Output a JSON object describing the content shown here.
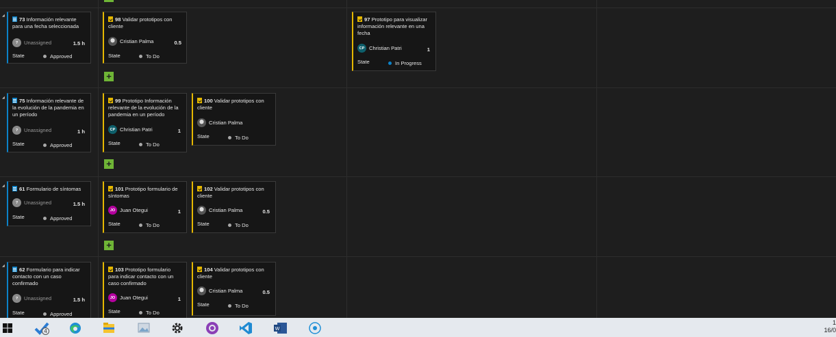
{
  "board": {
    "rows": [
      {
        "pbi": {
          "id": "73",
          "title": "Información relevante para una fecha seleccionada",
          "assignee": "Unassigned",
          "hours": "1.5 h",
          "state_label": "State",
          "state": "Approved"
        },
        "tasks": [
          {
            "id": "98",
            "title": "Validar prototipos con cliente",
            "assignee": "Cristian Palma",
            "avatar": "photo",
            "hours": "0.5",
            "state_label": "State",
            "state": "To Do"
          },
          {
            "id": "97",
            "title": "Prototipo para visualizar información relevante en una fecha",
            "assignee": "Christian Patri",
            "avatar_initials": "CP",
            "hours": "1",
            "state_label": "State",
            "state": "In Progress"
          }
        ]
      },
      {
        "pbi": {
          "id": "75",
          "title": "Información relevante de la evolución de la pandemia en un período",
          "assignee": "Unassigned",
          "hours": "1 h",
          "state_label": "State",
          "state": "Approved"
        },
        "tasks": [
          {
            "id": "99",
            "title": "Prototipo Información relevante de la evolución de la pandemia en un período",
            "assignee": "Christian Patri",
            "avatar_initials": "CP",
            "hours": "1",
            "state_label": "State",
            "state": "To Do"
          },
          {
            "id": "100",
            "title": "Validar prototipos con cliente",
            "assignee": "Cristian Palma",
            "avatar": "photo",
            "hours": "",
            "state_label": "State",
            "state": "To Do"
          }
        ]
      },
      {
        "pbi": {
          "id": "61",
          "title": "Formulario de síntomas",
          "assignee": "Unassigned",
          "hours": "1.5 h",
          "state_label": "State",
          "state": "Approved"
        },
        "tasks": [
          {
            "id": "101",
            "title": "Prototipo formulario de síntomas",
            "assignee": "Juan Otegui",
            "avatar_initials": "JO",
            "hours": "1",
            "state_label": "State",
            "state": "To Do"
          },
          {
            "id": "102",
            "title": "Validar prototipos con cliente",
            "assignee": "Cristian Palma",
            "avatar": "photo",
            "hours": "0.5",
            "state_label": "State",
            "state": "To Do"
          }
        ]
      },
      {
        "pbi": {
          "id": "62",
          "title": "Formulario para indicar contacto con un caso confirmado",
          "assignee": "Unassigned",
          "hours": "1.5 h",
          "state_label": "State",
          "state": "Approved"
        },
        "tasks": [
          {
            "id": "103",
            "title": "Prototipo formulario para indicar contacto con un caso confirmado",
            "assignee": "Juan Otegui",
            "avatar_initials": "JO",
            "hours": "1",
            "state_label": "State",
            "state": "To Do"
          },
          {
            "id": "104",
            "title": "Validar prototipos con cliente",
            "assignee": "Cristian Palma",
            "avatar": "photo",
            "hours": "0.5",
            "state_label": "State",
            "state": "To Do"
          }
        ]
      }
    ],
    "add_button": "+"
  },
  "taskbar": {
    "icons": [
      "windows-start-icon",
      "tasks-check-icon",
      "edge-browser-icon",
      "file-explorer-icon",
      "photos-app-icon",
      "settings-gear-icon",
      "github-desktop-icon",
      "vscode-icon",
      "word-icon",
      "cortana-circle-icon"
    ],
    "badge": "4",
    "clock_time": "1",
    "clock_date": "16/0"
  },
  "colors": {
    "pbi_accent": "#0c82c8",
    "task_accent": "#e6b800",
    "add_button": "#6fb536",
    "in_progress": "#0c82c8"
  }
}
